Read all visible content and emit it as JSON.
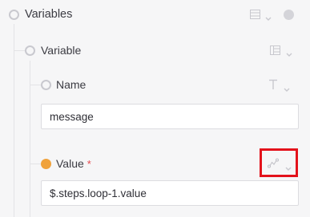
{
  "tree": {
    "root": {
      "label": "Variables",
      "status_icon": "circle-outline-icon",
      "menu_icon": "list-icon",
      "help_icon": "help-circle-icon"
    },
    "item": {
      "label": "Variable",
      "status_icon": "circle-outline-icon",
      "menu_icon": "table-icon"
    },
    "name_field": {
      "label": "Name",
      "status_icon": "circle-outline-icon",
      "type_icon": "text-type-icon",
      "value": "message"
    },
    "value_field": {
      "label": "Value",
      "required_mark": "*",
      "status_icon": "circle-filled-icon",
      "type_icon": "formula-icon",
      "value": "$.steps.loop-1.value"
    }
  },
  "colors": {
    "background": "#f6f6f7",
    "status_filled": "#f0a23b",
    "required": "#e5484d",
    "highlight": "#e3121b"
  }
}
